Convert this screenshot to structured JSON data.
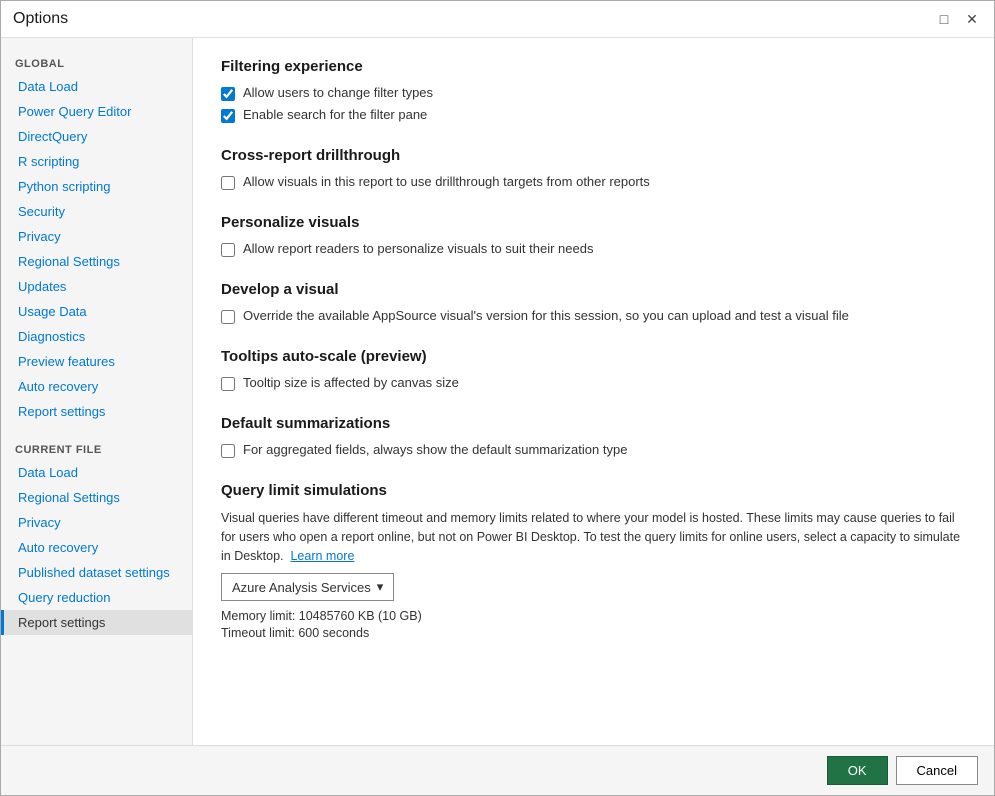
{
  "window": {
    "title": "Options",
    "min_icon": "□",
    "close_icon": "✕"
  },
  "sidebar": {
    "global_label": "GLOBAL",
    "global_items": [
      {
        "id": "data-load",
        "label": "Data Load",
        "active": false
      },
      {
        "id": "power-query-editor",
        "label": "Power Query Editor",
        "active": false
      },
      {
        "id": "directquery",
        "label": "DirectQuery",
        "active": false
      },
      {
        "id": "r-scripting",
        "label": "R scripting",
        "active": false
      },
      {
        "id": "python-scripting",
        "label": "Python scripting",
        "active": false
      },
      {
        "id": "security",
        "label": "Security",
        "active": false
      },
      {
        "id": "privacy",
        "label": "Privacy",
        "active": false
      },
      {
        "id": "regional-settings",
        "label": "Regional Settings",
        "active": false
      },
      {
        "id": "updates",
        "label": "Updates",
        "active": false
      },
      {
        "id": "usage-data",
        "label": "Usage Data",
        "active": false
      },
      {
        "id": "diagnostics",
        "label": "Diagnostics",
        "active": false
      },
      {
        "id": "preview-features",
        "label": "Preview features",
        "active": false
      },
      {
        "id": "auto-recovery",
        "label": "Auto recovery",
        "active": false
      },
      {
        "id": "report-settings-g",
        "label": "Report settings",
        "active": false
      }
    ],
    "current_file_label": "CURRENT FILE",
    "current_file_items": [
      {
        "id": "cf-data-load",
        "label": "Data Load",
        "active": false
      },
      {
        "id": "cf-regional-settings",
        "label": "Regional Settings",
        "active": false
      },
      {
        "id": "cf-privacy",
        "label": "Privacy",
        "active": false
      },
      {
        "id": "cf-auto-recovery",
        "label": "Auto recovery",
        "active": false
      },
      {
        "id": "cf-published-dataset",
        "label": "Published dataset settings",
        "active": false
      },
      {
        "id": "cf-query-reduction",
        "label": "Query reduction",
        "active": false
      },
      {
        "id": "cf-report-settings",
        "label": "Report settings",
        "active": true
      }
    ]
  },
  "main": {
    "sections": [
      {
        "id": "filtering-experience",
        "title": "Filtering experience",
        "checkboxes": [
          {
            "id": "allow-filter-types",
            "label": "Allow users to change filter types",
            "checked": true
          },
          {
            "id": "enable-search-filter",
            "label": "Enable search for the filter pane",
            "checked": true
          }
        ]
      },
      {
        "id": "cross-report",
        "title": "Cross-report drillthrough",
        "checkboxes": [
          {
            "id": "allow-visuals-drillthrough",
            "label": "Allow visuals in this report to use drillthrough targets from other reports",
            "checked": false
          }
        ]
      },
      {
        "id": "personalize-visuals",
        "title": "Personalize visuals",
        "checkboxes": [
          {
            "id": "allow-personalize",
            "label": "Allow report readers to personalize visuals to suit their needs",
            "checked": false
          }
        ]
      },
      {
        "id": "develop-visual",
        "title": "Develop a visual",
        "checkboxes": [
          {
            "id": "override-appsource",
            "label": "Override the available AppSource visual's version for this session, so you can upload and test a visual file",
            "checked": false
          }
        ]
      },
      {
        "id": "tooltips-autoscale",
        "title": "Tooltips auto-scale (preview)",
        "checkboxes": [
          {
            "id": "tooltip-canvas",
            "label": "Tooltip size is affected by canvas size",
            "checked": false
          }
        ]
      },
      {
        "id": "default-summarizations",
        "title": "Default summarizations",
        "checkboxes": [
          {
            "id": "show-default-summary",
            "label": "For aggregated fields, always show the default summarization type",
            "checked": false
          }
        ]
      }
    ],
    "query_limit_section": {
      "title": "Query limit simulations",
      "description": "Visual queries have different timeout and memory limits related to where your model is hosted. These limits may cause queries to fail for users who open a report online, but not on Power BI Desktop. To test the query limits for online users, select a capacity to simulate in Desktop.",
      "learn_more_label": "Learn more",
      "dropdown_label": "Azure Analysis Services",
      "dropdown_arrow": "▾",
      "memory_limit": "Memory limit: 10485760 KB (10 GB)",
      "timeout_limit": "Timeout limit: 600 seconds"
    }
  },
  "footer": {
    "ok_label": "OK",
    "cancel_label": "Cancel"
  }
}
